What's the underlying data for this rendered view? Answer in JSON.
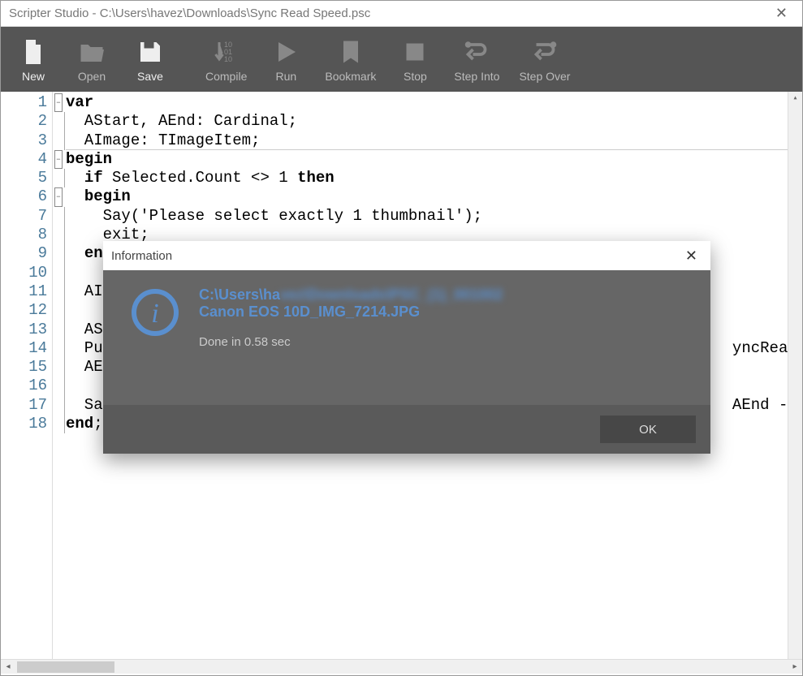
{
  "window": {
    "title": "Scripter Studio - C:\\Users\\havez\\Downloads\\Sync Read Speed.psc"
  },
  "toolbar": {
    "new": "New",
    "open": "Open",
    "save": "Save",
    "compile": "Compile",
    "run": "Run",
    "bookmark": "Bookmark",
    "stop": "Stop",
    "step_into": "Step Into",
    "step_over": "Step Over"
  },
  "code_lines": [
    {
      "n": 1,
      "t": "var",
      "kw": [
        [
          0,
          3
        ]
      ],
      "fold": "minus"
    },
    {
      "n": 2,
      "t": "  AStart, AEnd: Cardinal;"
    },
    {
      "n": 3,
      "t": "  AImage: TImageItem;",
      "border": true
    },
    {
      "n": 4,
      "t": "begin",
      "kw": [
        [
          0,
          5
        ]
      ],
      "fold": "minus"
    },
    {
      "n": 5,
      "t": "  if Selected.Count <> 1 then",
      "kw": [
        [
          2,
          4
        ],
        [
          25,
          29
        ]
      ]
    },
    {
      "n": 6,
      "t": "  begin",
      "kw": [
        [
          2,
          7
        ]
      ],
      "fold": "minus"
    },
    {
      "n": 7,
      "t": "    Say('Please select exactly 1 thumbnail');"
    },
    {
      "n": 8,
      "t": "    exit;"
    },
    {
      "n": 9,
      "t": "  end;",
      "kw": [
        [
          2,
          5
        ]
      ]
    },
    {
      "n": 10,
      "t": ""
    },
    {
      "n": 11,
      "t": "  AI"
    },
    {
      "n": 12,
      "t": ""
    },
    {
      "n": 13,
      "t": "  AS"
    },
    {
      "n": 14,
      "t": "  Pu                                                                    yncRead"
    },
    {
      "n": 15,
      "t": "  AE"
    },
    {
      "n": 16,
      "t": ""
    },
    {
      "n": 17,
      "t": "  Sa                                                                    AEnd -"
    },
    {
      "n": 18,
      "t": "end;",
      "kw": [
        [
          0,
          3
        ]
      ]
    }
  ],
  "dialog": {
    "title": "Information",
    "path_visible": "C:\\Users\\ha",
    "path_blurred": "vez\\Downloads\\PSC_(1)_001002",
    "filename": "Canon EOS 10D_IMG_7214.JPG",
    "status": "Done in 0.58 sec",
    "ok": "OK"
  }
}
